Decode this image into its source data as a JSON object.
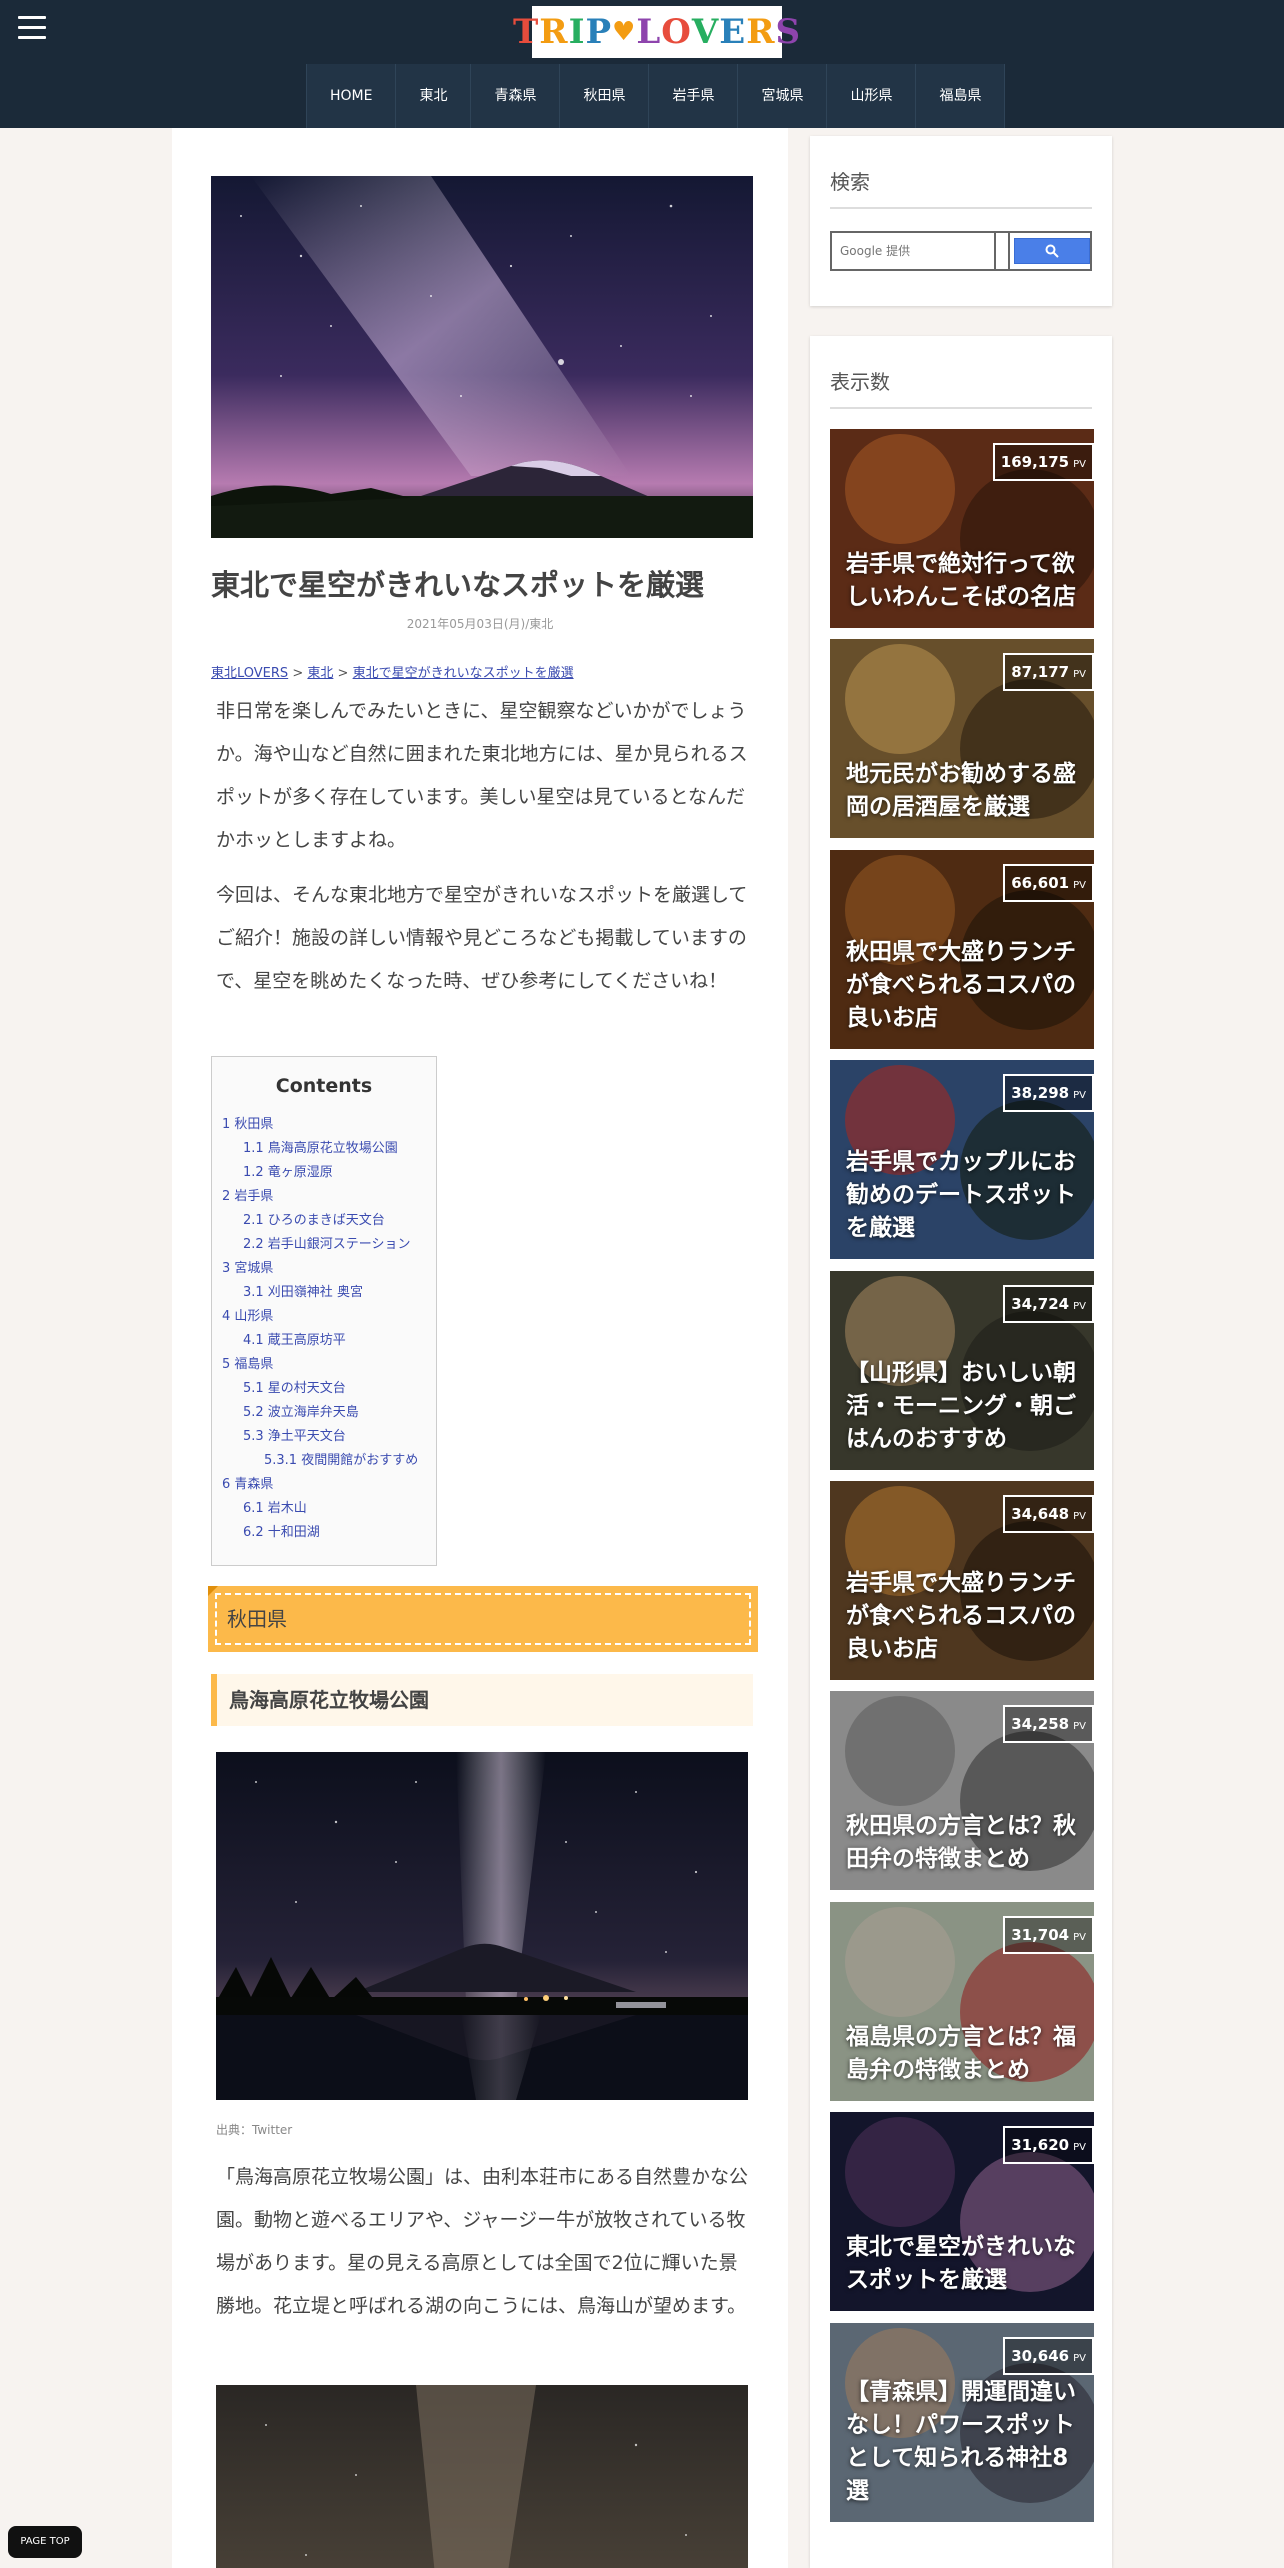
{
  "header": {
    "logo_text": "TRIP LOVERS",
    "nav": [
      "HOME",
      "東北",
      "青森県",
      "秋田県",
      "岩手県",
      "宮城県",
      "山形県",
      "福島県"
    ]
  },
  "article": {
    "title": "東北で星空がきれいなスポットを厳選",
    "date": "2021年05月03日(月)/東北",
    "breadcrumb": [
      "東北LOVERS",
      "東北",
      "東北で星空がきれいなスポットを厳選"
    ],
    "breadcrumb_sep": ">",
    "paragraphs": [
      "非日常を楽しんでみたいときに、星空観察などいかがでしょうか。海や山など自然に囲まれた東北地方には、星か見られるスポットが多く存在しています。美しい星空は見ているとなんだかホッとしますよね。",
      "今回は、そんな東北地方で星空がきれいなスポットを厳選してご紹介！施設の詳しい情報や見どころなども掲載していますので、星空を眺めたくなった時、ぜひ参考にしてくださいね！"
    ],
    "toc": {
      "title": "Contents",
      "items": [
        {
          "text": "1 秋田県",
          "level": 1
        },
        {
          "text": "1.1 鳥海高原花立牧場公園",
          "level": 2
        },
        {
          "text": "1.2 竜ヶ原湿原",
          "level": 2
        },
        {
          "text": "2 岩手県",
          "level": 1
        },
        {
          "text": "2.1 ひろのまきば天文台",
          "level": 2
        },
        {
          "text": "2.2 岩手山銀河ステーション",
          "level": 2
        },
        {
          "text": "3 宮城県",
          "level": 1
        },
        {
          "text": "3.1 刈田嶺神社 奥宮",
          "level": 2
        },
        {
          "text": "4 山形県",
          "level": 1
        },
        {
          "text": "4.1 蔵王高原坊平",
          "level": 2
        },
        {
          "text": "5 福島県",
          "level": 1
        },
        {
          "text": "5.1 星の村天文台",
          "level": 2
        },
        {
          "text": "5.2 波立海岸弁天島",
          "level": 2
        },
        {
          "text": "5.3 浄土平天文台",
          "level": 2
        },
        {
          "text": "5.3.1 夜間開館がおすすめ",
          "level": 3
        },
        {
          "text": "6 青森県",
          "level": 1
        },
        {
          "text": "6.1 岩木山",
          "level": 2
        },
        {
          "text": "6.2 十和田湖",
          "level": 2
        }
      ]
    },
    "section_h2": "秋田県",
    "section_h3": "鳥海高原花立牧場公園",
    "image_credit": "出典：Twitter",
    "section_paragraph": "「鳥海高原花立牧場公園」は、由利本荘市にある自然豊かな公園。動物と遊べるエリアや、ジャージー牛が放牧されている牧場があります。星の見える高原としては全国で2位に輝いた景勝地。花立堤と呼ばれる湖の向こうには、鳥海山が望めます。"
  },
  "sidebar": {
    "search": {
      "title": "検索",
      "placeholder": "Google 提供"
    },
    "ranking": {
      "title": "表示数",
      "pv_unit": "PV",
      "items": [
        {
          "pv": "169,175",
          "title": "岩手県で絶対行って欲しいわんこそばの名店"
        },
        {
          "pv": "87,177",
          "title": "地元民がお勧めする盛岡の居酒屋を厳選"
        },
        {
          "pv": "66,601",
          "title": "秋田県で大盛りランチが食べられるコスパの良いお店"
        },
        {
          "pv": "38,298",
          "title": "岩手県でカップルにお勧めのデートスポットを厳選"
        },
        {
          "pv": "34,724",
          "title": "【山形県】おいしい朝活・モーニング・朝ごはんのおすすめ"
        },
        {
          "pv": "34,648",
          "title": "岩手県で大盛りランチが食べられるコスパの良いお店"
        },
        {
          "pv": "34,258",
          "title": "秋田県の方言とは？秋田弁の特徴まとめ"
        },
        {
          "pv": "31,704",
          "title": "福島県の方言とは？福島弁の特徴まとめ"
        },
        {
          "pv": "31,620",
          "title": "東北で星空がきれいなスポットを厳選"
        },
        {
          "pv": "30,646",
          "title": "【青森県】開運間違いなし！パワースポットとして知られる神社8選"
        }
      ]
    }
  },
  "page_top_label": "PAGE TOP"
}
